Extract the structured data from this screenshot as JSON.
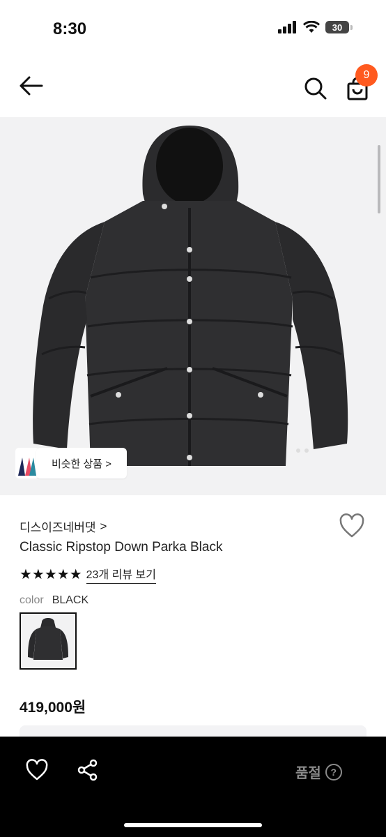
{
  "status_bar": {
    "time": "8:30",
    "battery": "30"
  },
  "nav": {
    "cart_count": "9"
  },
  "product": {
    "similar_label": "비슷한 상품 >",
    "brand": "디스이즈네버댓",
    "brand_chevron": ">",
    "name": "Classic Ripstop Down Parka Black",
    "stars": "★★★★★",
    "review_link": "23개 리뷰 보기",
    "color_key": "color",
    "color_value": "BLACK",
    "price": "419,000원"
  },
  "bottom_bar": {
    "sold_out": "품절",
    "help": "?"
  },
  "icons": [
    "back-arrow-icon",
    "search-icon",
    "shopping-bag-icon",
    "heart-icon",
    "share-icon",
    "help-icon",
    "chevron-right-icon"
  ],
  "colors": {
    "badge": "#ff5a1f",
    "bottom_bar": "#000000",
    "image_bg": "#f2f2f3"
  }
}
